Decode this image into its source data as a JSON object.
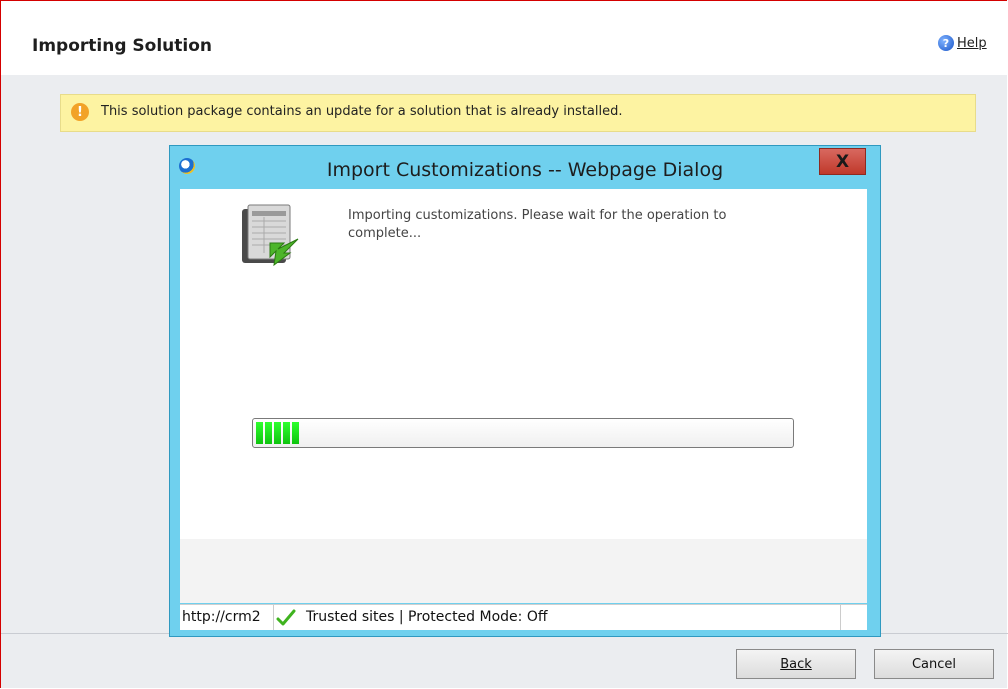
{
  "page": {
    "title": "Importing Solution",
    "help_label": "Help"
  },
  "warning": {
    "text": "This solution package contains an update for a solution that is already installed."
  },
  "dialog": {
    "title": "Import Customizations -- Webpage Dialog",
    "close_label": "X",
    "message": "Importing customizations. Please wait for the operation to complete...",
    "progress_fraction": 0.09,
    "status": {
      "url": "http://crm2",
      "zone": "Trusted sites | Protected Mode: Off"
    }
  },
  "buttons": {
    "back": "Back",
    "cancel": "Cancel"
  },
  "icons": [
    "help-icon",
    "warning-icon",
    "ie-icon",
    "close-icon",
    "import-document-icon",
    "trusted-check-icon",
    "resize-grip-icon"
  ],
  "colors": {
    "accent_frame": "#d40000",
    "dialog_chrome": "#6fd0ee",
    "warning_bg": "#fdf3a2",
    "progress": "#0ec40e",
    "close": "#c0392b"
  }
}
